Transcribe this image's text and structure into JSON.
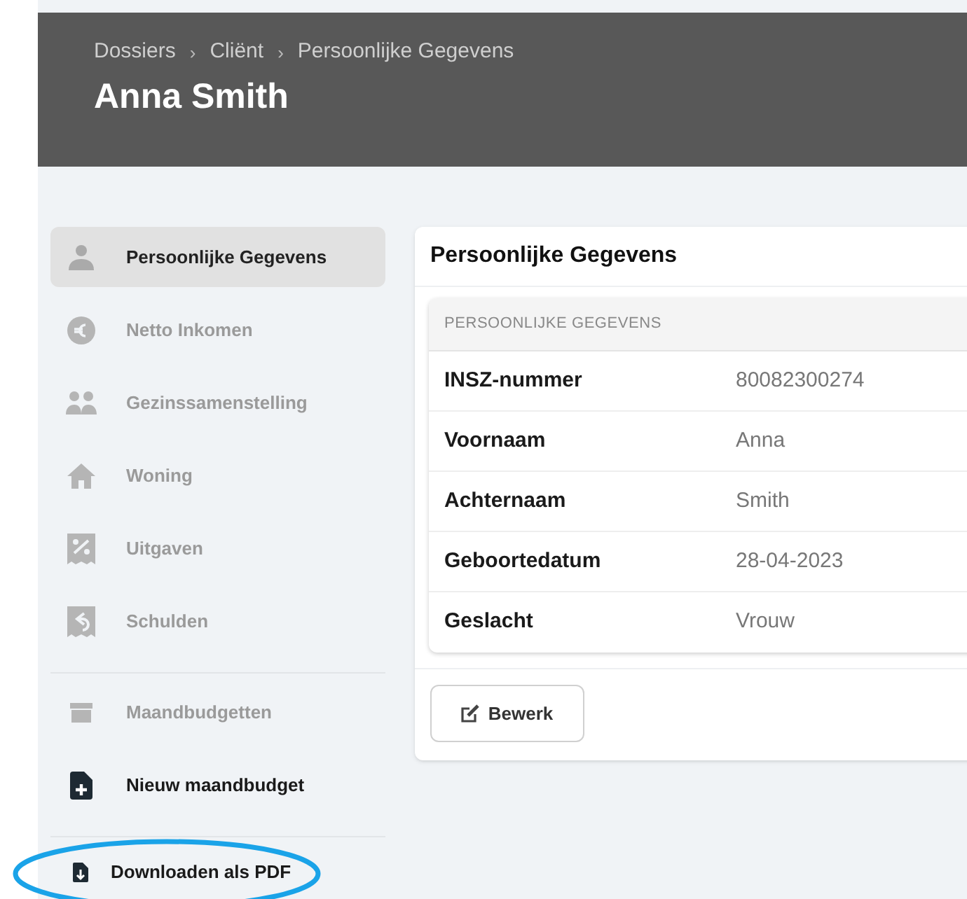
{
  "header": {
    "breadcrumbs": [
      "Dossiers",
      "Cliënt",
      "Persoonlijke Gegevens"
    ],
    "separator": "›",
    "title": "Anna Smith"
  },
  "sidebar": {
    "sections": [
      [
        {
          "label": "Persoonlijke Gegevens",
          "kind": "nav",
          "selected": true
        },
        {
          "label": "Netto Inkomen",
          "kind": "nav",
          "selected": false
        },
        {
          "label": "Gezinssamenstelling",
          "kind": "nav",
          "selected": false
        },
        {
          "label": "Woning",
          "kind": "nav",
          "selected": false
        },
        {
          "label": "Uitgaven",
          "kind": "nav",
          "selected": false
        },
        {
          "label": "Schulden",
          "kind": "nav",
          "selected": false
        }
      ],
      [
        {
          "label": "Maandbudgetten",
          "kind": "nav",
          "selected": false
        },
        {
          "label": "Nieuw maandbudget",
          "kind": "action",
          "selected": false
        }
      ],
      [
        {
          "label": "Downloaden als PDF",
          "kind": "action",
          "selected": false,
          "highlighted": true
        }
      ]
    ]
  },
  "card": {
    "title": "Persoonlijke Gegevens",
    "table_heading": "PERSOONLIJKE GEGEVENS",
    "rows": [
      {
        "label": "INSZ-nummer",
        "value": "80082300274"
      },
      {
        "label": "Voornaam",
        "value": "Anna"
      },
      {
        "label": "Achternaam",
        "value": "Smith"
      },
      {
        "label": "Geboortedatum",
        "value": "28-04-2023"
      },
      {
        "label": "Geslacht",
        "value": "Vrouw"
      }
    ],
    "button": "Bewerk"
  }
}
